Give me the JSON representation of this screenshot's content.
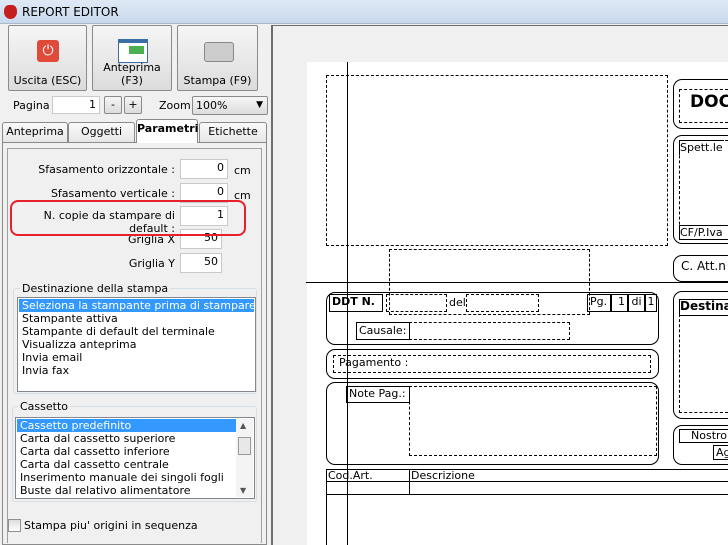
{
  "window": {
    "title": "REPORT EDITOR"
  },
  "toolbar": {
    "exit": "Uscita (ESC)",
    "preview": "Anteprima (F3)",
    "print": "Stampa (F9)"
  },
  "paging": {
    "page_label": "Pagina",
    "page_value": "1",
    "minus": "-",
    "plus": "+",
    "zoom_label": "Zoom",
    "zoom_value": "100%"
  },
  "tabs": [
    "Anteprima",
    "Oggetti",
    "Parametri",
    "Etichette"
  ],
  "params": {
    "offset_h_label": "Sfasamento orizzontale :",
    "offset_h": "0",
    "offset_h_unit": "cm",
    "offset_v_label": "Sfasamento verticale :",
    "offset_v": "0",
    "offset_v_unit": "cm",
    "copies_label": "N. copie da stampare di default :",
    "copies": "1",
    "grid_x_label": "Griglia X",
    "grid_x": "50",
    "grid_y_label": "Griglia Y",
    "grid_y": "50"
  },
  "destination": {
    "label": "Destinazione della stampa",
    "items": [
      "Seleziona la stampante prima di stampare",
      "Stampante attiva",
      "Stampante di default del terminale",
      "Visualizza anteprima",
      "Invia email",
      "Invia fax"
    ]
  },
  "tray": {
    "label": "Cassetto",
    "items": [
      "Cassetto predefinito",
      "Carta dal cassetto superiore",
      "Carta dal cassetto inferiore",
      "Carta dal cassetto centrale",
      "Inserimento manuale dei singoli fogli",
      "Buste dal relativo alimentatore"
    ]
  },
  "sequence_checkbox": "Stampa piu' origini in sequenza",
  "report": {
    "doc": "DOC",
    "spett": "Spett.le",
    "cf": "CF/P.Iva",
    "catt": "C. Att.n",
    "ddt": "DDT N.",
    "del": "del",
    "pg": "Pg.",
    "pg_num": "1",
    "di": "di",
    "pg_tot": "1",
    "causale": "Causale:",
    "pagamento": "Pagamento :",
    "note": "Note Pag.:",
    "destina": "Destina",
    "nostro": "Nostro",
    "ag": "Ag",
    "col_cod": "Cod.Art.",
    "col_desc": "Descrizione"
  },
  "colors": {
    "selection": "#3399ff",
    "highlight": "#e8202a"
  }
}
